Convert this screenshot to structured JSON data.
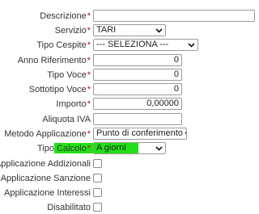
{
  "form": {
    "descrizione": {
      "label": "Descrizione",
      "value": "",
      "required": "*"
    },
    "servizio": {
      "label": "Servizio",
      "value": "TARI",
      "required": "*"
    },
    "tipo_cespite": {
      "label": "Tipo Cespite",
      "value": "--- SELEZIONA ---",
      "required": "*"
    },
    "anno_riferimento": {
      "label": "Anno Riferimento",
      "value": "0",
      "required": "*"
    },
    "tipo_voce": {
      "label": "Tipo Voce",
      "value": "0",
      "required": "*"
    },
    "sottotipo_voce": {
      "label": "Sottotipo Voce",
      "value": "0",
      "required": "*"
    },
    "importo": {
      "label": "Importo",
      "value": "0,00000",
      "required": "*"
    },
    "aliquota_iva": {
      "label": "Aliquota IVA",
      "value": ""
    },
    "metodo_applicazione": {
      "label": "Metodo Applicazione",
      "value": "Punto di conferimento",
      "required": "*"
    },
    "tipo_calcolo": {
      "label": "Tipo Calcolo",
      "value": "A giorni",
      "required": "*"
    },
    "applicazione_addizionali": {
      "label": "Applicazione Addizionali"
    },
    "applicazione_sanzione": {
      "label": "Applicazione Sanzione"
    },
    "applicazione_interessi": {
      "label": "Applicazione Interessi"
    },
    "disabilitato": {
      "label": "Disabilitato"
    }
  },
  "colors": {
    "highlight": "#22e016",
    "required": "#d0021b"
  }
}
